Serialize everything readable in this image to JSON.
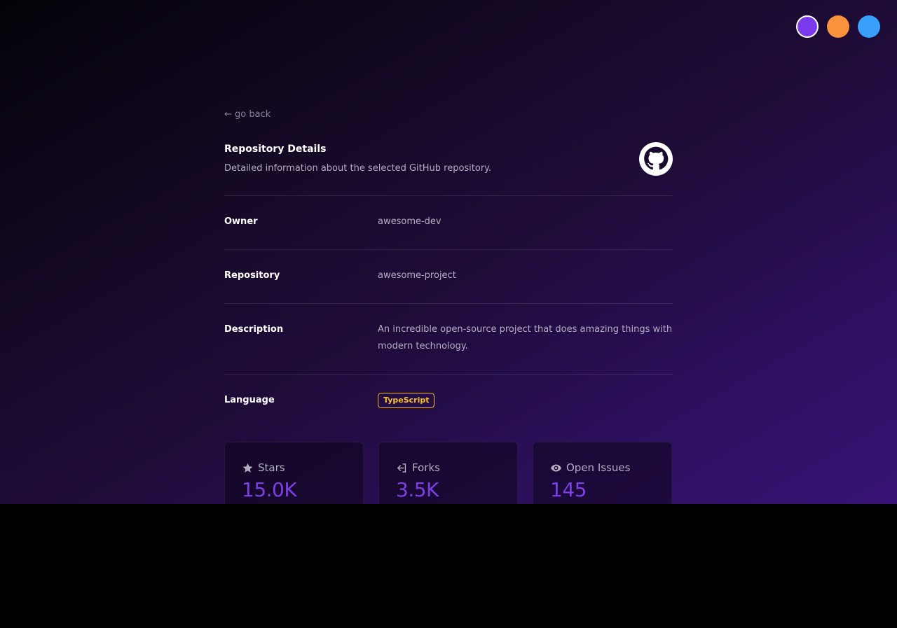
{
  "theme": {
    "options": [
      {
        "name": "purple",
        "color": "#7c3aed",
        "active": true
      },
      {
        "name": "orange",
        "color": "#fb923c",
        "active": false
      },
      {
        "name": "blue",
        "color": "#38a0fb",
        "active": false
      }
    ]
  },
  "nav": {
    "back_label": "← go back"
  },
  "header": {
    "title": "Repository Details",
    "subtitle": "Detailed information about the selected GitHub repository.",
    "icon": "github-icon"
  },
  "details": {
    "owner": {
      "label": "Owner",
      "value": "awesome-dev"
    },
    "repository": {
      "label": "Repository",
      "value": "awesome-project"
    },
    "description": {
      "label": "Description",
      "value": "An incredible open-source project that does amazing things with modern technology."
    },
    "language": {
      "label": "Language",
      "value": "TypeScript",
      "color": "#f6c02a"
    }
  },
  "stats": {
    "stars": {
      "label": "Stars",
      "value": "15.0K",
      "icon": "star-icon"
    },
    "forks": {
      "label": "Forks",
      "value": "3.5K",
      "icon": "fork-icon"
    },
    "issues": {
      "label": "Open Issues",
      "value": "145",
      "icon": "eye-icon"
    }
  },
  "colors": {
    "accent": "#7b3fe4",
    "muted_text": "#b3adc2"
  }
}
